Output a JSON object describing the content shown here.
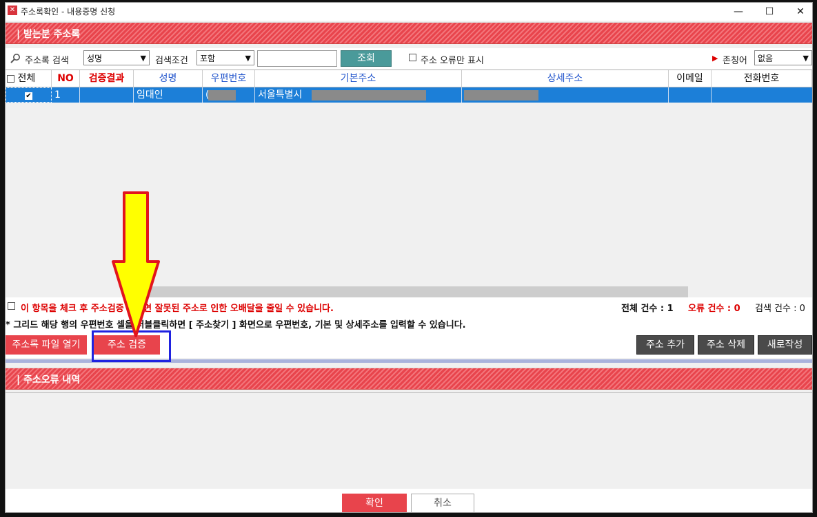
{
  "window": {
    "title": "주소록확인 - 내용증명 신청",
    "min": "—",
    "max": "☐",
    "close": "✕"
  },
  "section_address": {
    "title": "| 받는분 주소록"
  },
  "search": {
    "label": "주소록 검색",
    "field_value": "성명",
    "condition_label": "검색조건",
    "condition_value": "포함",
    "search_button": "조회",
    "error_only_label": "주소 오류만 표시",
    "honorific_label": "존칭어",
    "honorific_value": "없음"
  },
  "grid": {
    "headers": [
      "전체",
      "NO",
      "검증결과",
      "성명",
      "우편번호",
      "기본주소",
      "상세주소",
      "이메일",
      "전화번호"
    ],
    "rows": [
      {
        "no": "1",
        "verify": "",
        "name": "임대인",
        "zip_prefix": "(",
        "address": "서울특별시"
      }
    ]
  },
  "info": {
    "check_notice": "이 항목을 체크 후 주소검증 하시면 잘못된 주소로 인한 오배달을 줄일 수 있습니다.",
    "total_count": "전체 건수 : 1",
    "error_count": "오류 건수 : 0",
    "search_count": "검색 건수 : 0",
    "hint": "* 그리드 해당 행의 우편번호 셀을 더블클릭하면 [ 주소찾기 ] 화면으로 우편번호, 기본 및 상세주소를 입력할 수 있습니다."
  },
  "buttons": {
    "open_file": "주소록 파일 열기",
    "verify": "주소 검증",
    "add": "주소 추가",
    "delete": "주소 삭제",
    "new": "새로작성",
    "ok": "확인",
    "cancel": "취소"
  },
  "section_error": {
    "title": "| 주소오류 내역"
  },
  "colors": {
    "accent_red": "#e8444c",
    "selected_row": "#1c7fd8",
    "teal_button": "#4a9a9a",
    "annotation_blue": "#1f22e0",
    "arrow_yellow": "#ffff00",
    "arrow_red": "#e2141c"
  }
}
